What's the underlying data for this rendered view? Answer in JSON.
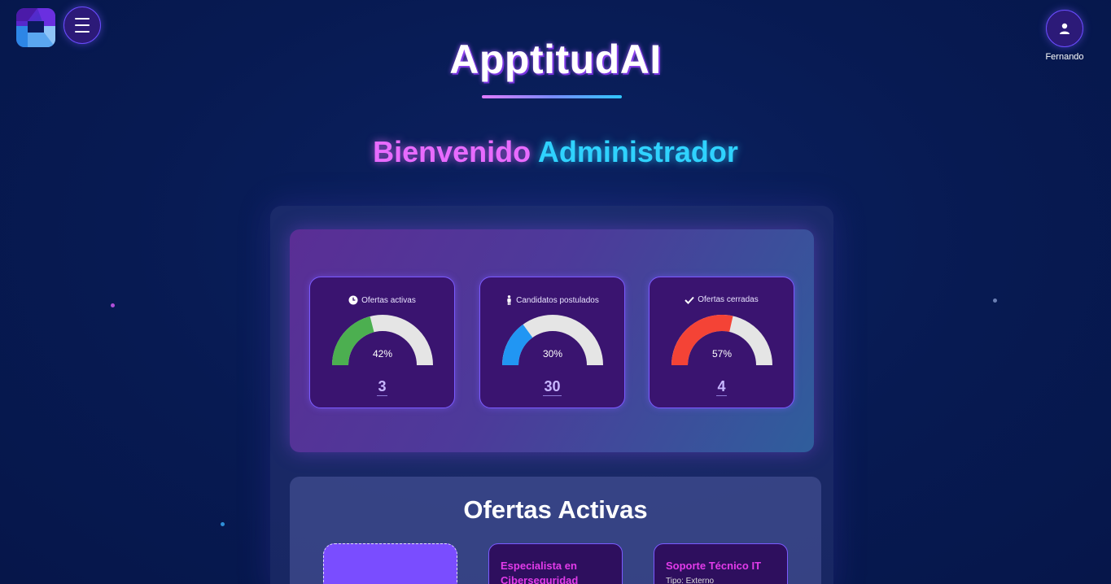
{
  "app": {
    "title": "ApptitudAI"
  },
  "header": {
    "user_name": "Fernando"
  },
  "welcome": {
    "part1": "Bienvenido",
    "part2": "Administrador"
  },
  "stats": [
    {
      "label": "Ofertas activas",
      "icon": "clock-icon",
      "percent": 42,
      "percent_label": "42%",
      "value": "3",
      "color": "#4caf50"
    },
    {
      "label": "Candidatos postulados",
      "icon": "person-icon",
      "percent": 30,
      "percent_label": "30%",
      "value": "30",
      "color": "#2196f3"
    },
    {
      "label": "Ofertas cerradas",
      "icon": "check-icon",
      "percent": 57,
      "percent_label": "57%",
      "value": "4",
      "color": "#f44336"
    }
  ],
  "offers": {
    "title": "Ofertas Activas",
    "items": [
      {
        "title": "Especialista en Ciberseguridad"
      },
      {
        "title": "Soporte Técnico IT",
        "subtitle": "Tipo: Externo"
      }
    ]
  }
}
